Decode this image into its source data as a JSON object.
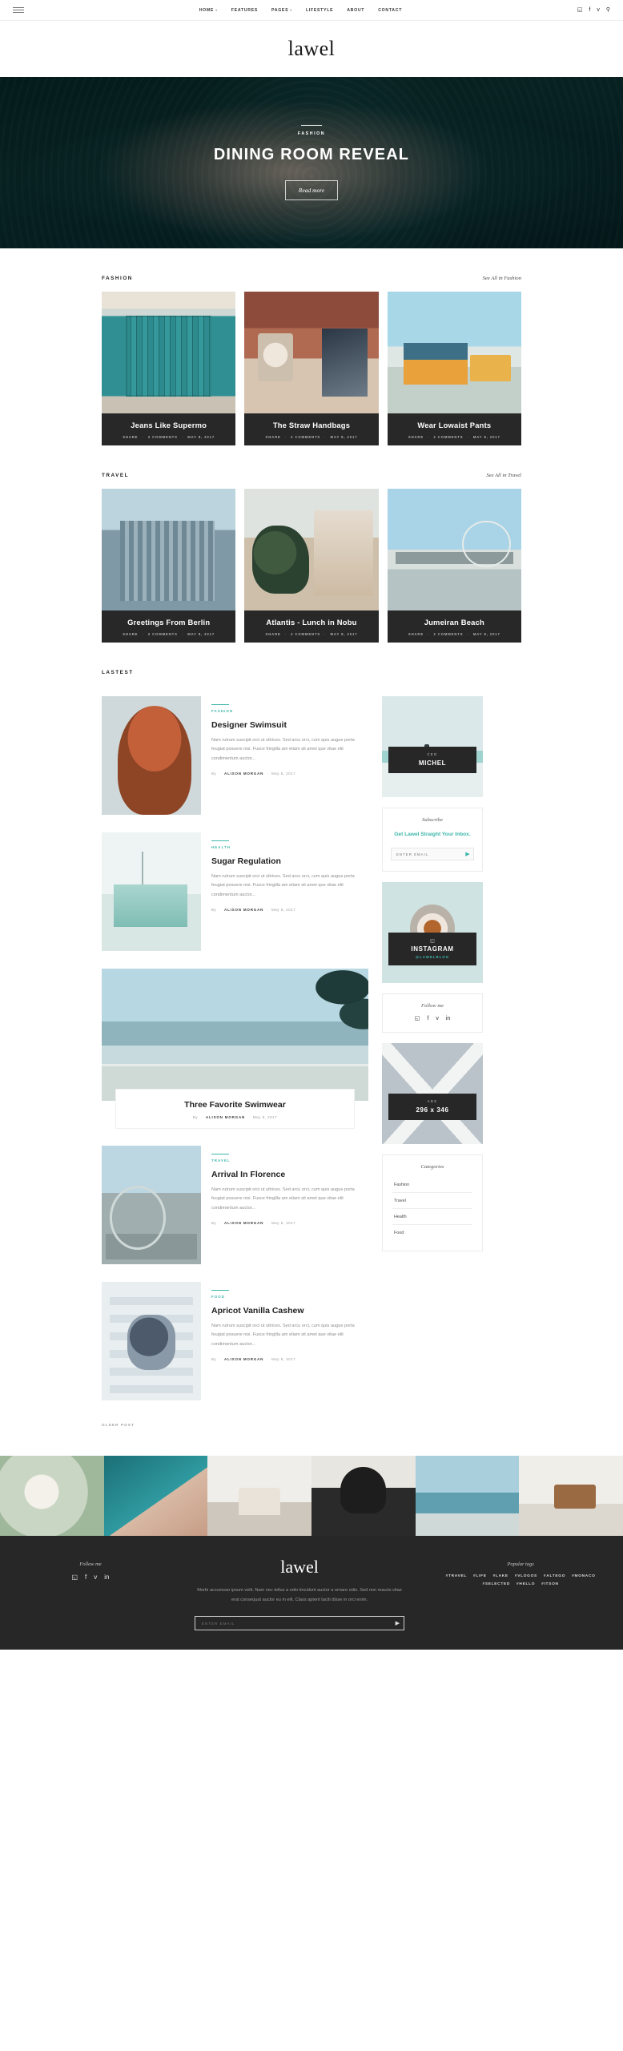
{
  "brand": {
    "name": "lawel",
    "accent": "#3cb6a9",
    "dark": "#272727"
  },
  "topbar": {
    "menu_icon": "hamburger-icon",
    "nav": [
      {
        "label": "HOME",
        "caret": "▾"
      },
      {
        "label": "FEATURES",
        "caret": ""
      },
      {
        "label": "PAGES",
        "caret": "▾"
      },
      {
        "label": "LIFESTYLE",
        "caret": ""
      },
      {
        "label": "ABOUT",
        "caret": ""
      },
      {
        "label": "CONTACT",
        "caret": ""
      }
    ],
    "social": [
      {
        "name": "instagram-icon",
        "glyph": "◱"
      },
      {
        "name": "facebook-icon",
        "glyph": "f"
      },
      {
        "name": "twitter-icon",
        "glyph": "ᴠ"
      },
      {
        "name": "search-icon",
        "glyph": "⚲"
      }
    ]
  },
  "hero": {
    "category": "FASHION",
    "title": "DINING ROOM REVEAL",
    "button": "Read more"
  },
  "sections": [
    {
      "title": "FASHION",
      "link": "See All in Fashion",
      "cards": [
        {
          "title": "Jeans Like Supermo",
          "share": "SHARE",
          "comments": "2 COMMENTS",
          "date": "MAY 8, 2017",
          "photo": "p-door"
        },
        {
          "title": "The Straw Handbags",
          "share": "SHARE",
          "comments": "2 COMMENTS",
          "date": "MAY 8, 2017",
          "photo": "p-laundry"
        },
        {
          "title": "Wear Lowaist Pants",
          "share": "SHARE",
          "comments": "2 COMMENTS",
          "date": "MAY 8, 2017",
          "photo": "p-beach"
        }
      ]
    },
    {
      "title": "TRAVEL",
      "link": "See All in Travel",
      "cards": [
        {
          "title": "Greetings From Berlin",
          "share": "SHARE",
          "comments": "2 COMMENTS",
          "date": "MAY 8, 2017",
          "photo": "p-berlin"
        },
        {
          "title": "Atlantis - Lunch in Nobu",
          "share": "SHARE",
          "comments": "2 COMMENTS",
          "date": "MAY 8, 2017",
          "photo": "p-atlantis"
        },
        {
          "title": "Jumeiran Beach",
          "share": "SHARE",
          "comments": "2 COMMENTS",
          "date": "MAY 8, 2017",
          "photo": "p-pier"
        }
      ]
    }
  ],
  "latest": {
    "title": "LASTEST",
    "older_label": "OLDER POST",
    "excerpt": "Nam rutrum suscipit orci ut ultrices. Sed arcu orci, cum quis augue porta feugiat posuere nisi. Fusce fringilla am etiam sit amet que vitae elit condimentum auctor...",
    "by_prefix": "By",
    "author": "ALISON MORGAN",
    "date": "May 8, 2017",
    "posts": [
      {
        "category": "FASHION",
        "title": "Designer Swimsuit",
        "photo": "p-hair",
        "layout": "side"
      },
      {
        "category": "HEALTH",
        "title": "Sugar Regulation",
        "photo": "p-lifeguard",
        "layout": "side"
      },
      {
        "category": "",
        "title": "Three Favorite Swimwear",
        "photo": "p-palms",
        "layout": "feature"
      },
      {
        "category": "TRAVEL",
        "title": "Arrival In Florence",
        "photo": "p-florence",
        "layout": "side"
      },
      {
        "category": "FOOD",
        "title": "Apricot Vanilla Cashew",
        "photo": "p-cashew",
        "layout": "side"
      }
    ]
  },
  "sidebar": {
    "author_widget": {
      "role": "CEO",
      "name": "MICHEL",
      "photo": "p-surf"
    },
    "subscribe": {
      "title": "Subscribe",
      "headline": "Get Lawel Straight Your Inbox.",
      "placeholder": "ENTER EMAIL",
      "submit_glyph": "▶"
    },
    "instagram": {
      "label": "INSTAGRAM",
      "handle": "@LAWELBLOG",
      "icon_glyph": "◱",
      "photo": "p-coffee"
    },
    "follow": {
      "title": "Follow me",
      "social": [
        {
          "name": "instagram-icon",
          "glyph": "◱"
        },
        {
          "name": "facebook-icon",
          "glyph": "f"
        },
        {
          "name": "twitter-icon",
          "glyph": "ᴠ"
        },
        {
          "name": "linkedin-icon",
          "glyph": "in"
        }
      ]
    },
    "ads": {
      "small": "ADS",
      "size": "296 x 346",
      "photo": "p-ads"
    },
    "categories": {
      "title": "Categories",
      "items": [
        "Fashion",
        "Travel",
        "Health",
        "Food"
      ]
    }
  },
  "instagram_strip": [
    "ig1",
    "ig2",
    "ig3",
    "ig4",
    "ig5",
    "ig6"
  ],
  "footer": {
    "follow_title": "Follow me",
    "social": [
      {
        "name": "instagram-icon",
        "glyph": "◱"
      },
      {
        "name": "facebook-icon",
        "glyph": "f"
      },
      {
        "name": "twitter-icon",
        "glyph": "ᴠ"
      },
      {
        "name": "linkedin-icon",
        "glyph": "in"
      }
    ],
    "logo": "lawel",
    "description": "Morbi accumsan ipsum velit. Nam nec tellus a odio tincidunt auctor a ornare odio. Sed non mauris vitae erat consequat auctor eu in elit. Class aptent taciti disse in orci enim.",
    "email_placeholder": "ENTER EMAIL",
    "submit_glyph": "▶",
    "tags_title": "Popular tags",
    "tags": [
      "#TRAVEL",
      "#LIFE",
      "#LAKE",
      "#VLOGOS",
      "#ALTEGO",
      "#MONACO",
      "#SELECTED",
      "#HELLO",
      "#ITSON"
    ]
  }
}
